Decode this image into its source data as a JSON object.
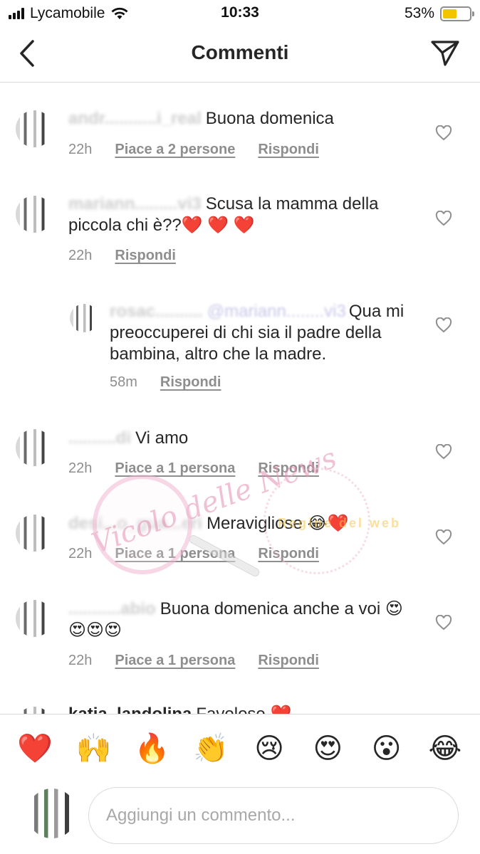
{
  "status_bar": {
    "carrier": "Lycamobile",
    "time": "10:33",
    "battery": "53%",
    "battery_level": 0.53
  },
  "header": {
    "title": "Commenti",
    "back_icon": "chevron-left-icon",
    "send_icon": "paper-plane-icon"
  },
  "comments": [
    {
      "username": "andr...........i_real",
      "text": "Buona domenica",
      "time": "22h",
      "likes": "Piace a 2 persone",
      "reply": "Rispondi"
    },
    {
      "username": "mariann.........vi3",
      "text": "Scusa la mamma della piccola chi è??❤️ ❤️ ❤️",
      "time": "22h",
      "likes": "",
      "reply": "Rispondi"
    },
    {
      "username": "rosac..........",
      "mention": "@mariann........vi3",
      "text": "Qua mi preoccuperei di chi sia il padre della bambina, altro che la madre.",
      "time": "58m",
      "likes": "",
      "reply": "Rispondi"
    },
    {
      "username": "..........di",
      "text": "Vi amo",
      "time": "22h",
      "likes": "Piace a 1 persona",
      "reply": "Rispondi"
    },
    {
      "username": "desi...o_gua...eri",
      "text": "Meravigliose 😂❤️",
      "time": "22h",
      "likes": "Piace a 1 persona",
      "reply": "Rispondi"
    },
    {
      "username": "...........abio",
      "text": "Buona domenica anche a voi 😍😍😍😍",
      "time": "22h",
      "likes": "Piace a 1 persona",
      "reply": "Rispondi"
    },
    {
      "username": "katia_landolina",
      "text": "Favolose ❤️",
      "time": "",
      "likes": "",
      "reply": ""
    }
  ],
  "emoji_bar": [
    "❤️",
    "🙌",
    "🔥",
    "👏",
    "😢",
    "😍",
    "😮",
    "😂"
  ],
  "composer": {
    "placeholder": "Aggiungi un commento..."
  },
  "watermark": {
    "script": "Vicolo delle News",
    "site": "Regine del web"
  }
}
